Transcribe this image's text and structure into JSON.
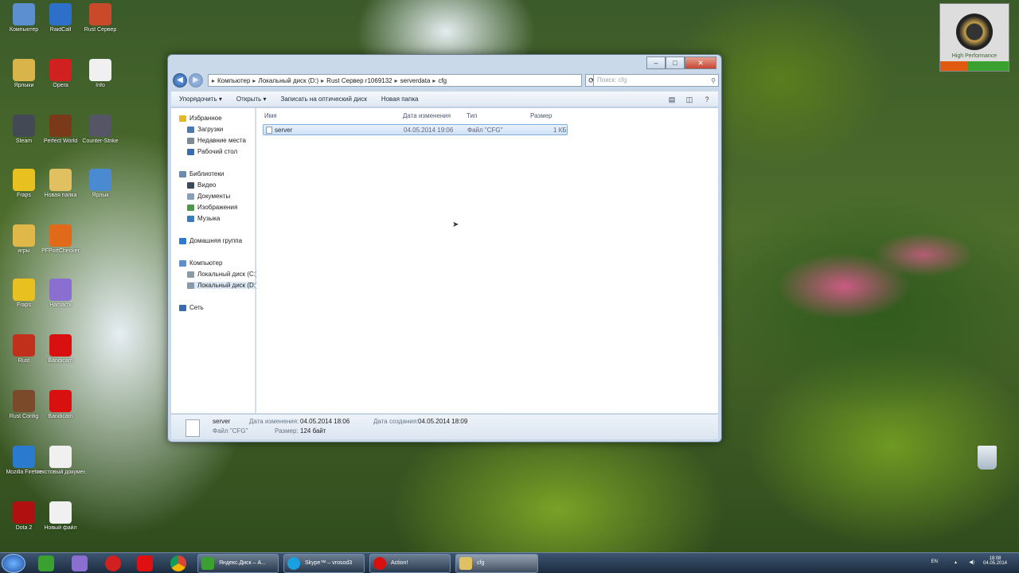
{
  "desktop_icons": [
    {
      "label": "Компьютер",
      "color": "#5b8fcf"
    },
    {
      "label": "RaidCall",
      "color": "#2d6fc9"
    },
    {
      "label": "Rust Сервер",
      "color": "#c84a2b"
    },
    {
      "label": "Ярлыки",
      "color": "#d9b44a"
    },
    {
      "label": "Opera",
      "color": "#d12020"
    },
    {
      "label": "Info",
      "color": "#f0f0f0"
    },
    {
      "label": "Steam",
      "color": "#444a55"
    },
    {
      "label": "Perfect World",
      "color": "#7a3a1a"
    },
    {
      "label": "Counter-Strike",
      "color": "#556"
    },
    {
      "label": "Fraps",
      "color": "#e8c020"
    },
    {
      "label": "Новая папка",
      "color": "#e0c060"
    },
    {
      "label": "Ярлык",
      "color": "#4a8ad0"
    },
    {
      "label": "игры",
      "color": "#e0b84a"
    },
    {
      "label": "PFPortChecker",
      "color": "#e06a1a"
    },
    {
      "label": "Fraps",
      "color": "#e8c020"
    },
    {
      "label": "Hamachi",
      "color": "#8a6fd0"
    },
    {
      "label": "Rust",
      "color": "#c0301a"
    },
    {
      "label": "Bandicam",
      "color": "#d91010"
    },
    {
      "label": "Rust Config",
      "color": "#7a4a2a"
    },
    {
      "label": "Bandicam",
      "color": "#d91010"
    },
    {
      "label": "Mozilla Firefox",
      "color": "#2a7ad0"
    },
    {
      "label": "текстовый документ",
      "color": "#f0f0f0"
    },
    {
      "label": "Dota 2",
      "color": "#b01010"
    },
    {
      "label": "Новый файл",
      "color": "#f0f0f0"
    }
  ],
  "explorer": {
    "address": [
      "Компьютер",
      "Локальный диск (D:)",
      "Rust Сервер r1069132",
      "serverdata",
      "cfg"
    ],
    "search_placeholder": "Поиск: cfg",
    "toolbar": [
      "Упорядочить ▾",
      "Открыть ▾",
      "Записать на оптический диск",
      "Новая папка"
    ],
    "nav": [
      {
        "label": "Избранное",
        "icon": "star-icon",
        "color": "#e8b820"
      },
      {
        "label": "Загрузки",
        "icon": "download-icon",
        "color": "#4a7ab0"
      },
      {
        "label": "Недавние места",
        "icon": "recent-icon",
        "color": "#7a8a9a"
      },
      {
        "label": "Рабочий стол",
        "icon": "desktop-icon",
        "color": "#3a6ab0"
      },
      {
        "label": "Библиотеки",
        "icon": "library-icon",
        "color": "#6a8ab0"
      },
      {
        "label": "Видео",
        "icon": "video-icon",
        "color": "#3a4a5a"
      },
      {
        "label": "Документы",
        "icon": "document-icon",
        "color": "#8aa0b8"
      },
      {
        "label": "Изображения",
        "icon": "image-icon",
        "color": "#4a9a4a"
      },
      {
        "label": "Музыка",
        "icon": "music-icon",
        "color": "#3a7ac0"
      },
      {
        "label": "Домашняя группа",
        "icon": "homegroup-icon",
        "color": "#2a7ad0"
      },
      {
        "label": "Компьютер",
        "icon": "computer-icon",
        "color": "#5b8fcf"
      },
      {
        "label": "Локальный диск (C:)",
        "icon": "drive-icon",
        "color": "#8a9aaa"
      },
      {
        "label": "Локальный диск (D:)",
        "icon": "drive-icon",
        "color": "#8a9aaa"
      },
      {
        "label": "Сеть",
        "icon": "network-icon",
        "color": "#3a6ab0"
      }
    ],
    "columns": [
      "Имя",
      "Дата изменения",
      "Тип",
      "Размер"
    ],
    "files": [
      {
        "name": "server",
        "date": "04.05.2014 19:06",
        "type": "Файл \"CFG\"",
        "size": "1 КБ"
      }
    ],
    "details": {
      "name": "server",
      "type": "Файл \"CFG\"",
      "modified_label": "Дата изменения:",
      "modified": "04.05.2014 18:06",
      "size_label": "Размер:",
      "size": "124 байт",
      "created_label": "Дата создания:",
      "created": "04.05.2014 18:09"
    }
  },
  "taskbar": {
    "tasks": [
      "Яндекс.Диск – А...",
      "Skype™ – vrosod3",
      "Action!",
      "cfg"
    ],
    "lang": "EN",
    "time": "18:08",
    "date": "04.05.2014"
  },
  "overlay": {
    "label": "High Performance"
  }
}
